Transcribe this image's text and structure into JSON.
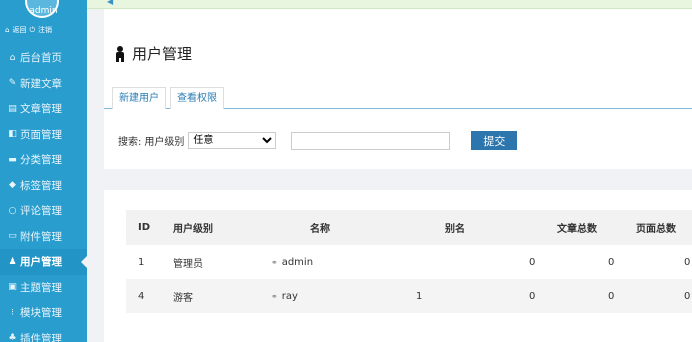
{
  "sidebar": {
    "username": "admin",
    "quick_links": {
      "back": "返回",
      "logout": "注销"
    },
    "items": [
      {
        "label": "后台首页",
        "icon": "home-icon"
      },
      {
        "label": "新建文章",
        "icon": "pen-icon"
      },
      {
        "label": "文章管理",
        "icon": "document-icon"
      },
      {
        "label": "页面管理",
        "icon": "page-icon"
      },
      {
        "label": "分类管理",
        "icon": "folder-icon"
      },
      {
        "label": "标签管理",
        "icon": "tag-icon"
      },
      {
        "label": "评论管理",
        "icon": "comment-icon"
      },
      {
        "label": "附件管理",
        "icon": "attachment-icon"
      },
      {
        "label": "用户管理",
        "icon": "user-icon",
        "active": true
      },
      {
        "label": "主题管理",
        "icon": "theme-icon"
      },
      {
        "label": "模块管理",
        "icon": "module-icon"
      },
      {
        "label": "插件管理",
        "icon": "plugin-icon"
      }
    ]
  },
  "page": {
    "title": "用户管理"
  },
  "tabs": [
    {
      "label": "新建用户"
    },
    {
      "label": "查看权限"
    }
  ],
  "search": {
    "label": "搜索:",
    "level_label": "用户级别",
    "level_value": "任意",
    "input_value": "",
    "submit_label": "提交"
  },
  "table": {
    "headers": {
      "id": "ID",
      "level": "用户级别",
      "name": "名称",
      "alias": "别名",
      "posts": "文章总数",
      "pages": "页面总数"
    },
    "rows": [
      {
        "id": "1",
        "level": "管理员",
        "name": "admin",
        "alias": "",
        "posts": "0",
        "pages": "0",
        "extra": "0"
      },
      {
        "id": "4",
        "level": "游客",
        "name": "ray",
        "alias": "1",
        "posts": "0",
        "pages": "0",
        "extra": "0"
      }
    ]
  },
  "colors": {
    "sidebar": "#2a9dcf",
    "accent": "#2d76ad",
    "notice": "#e8f6e0"
  }
}
